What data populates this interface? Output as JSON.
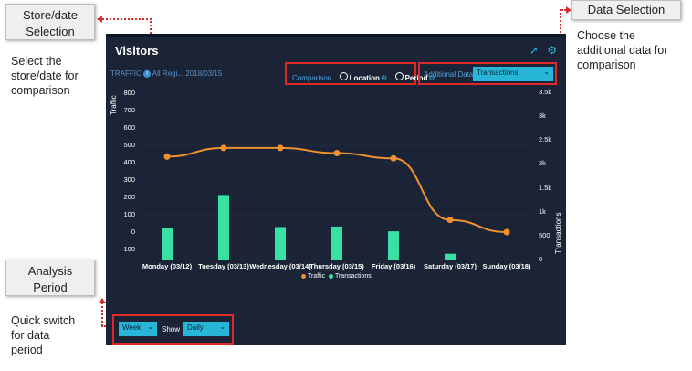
{
  "callouts": {
    "store_date": {
      "line1": "Store/date",
      "line2": "Selection",
      "desc": [
        "Select the",
        "store/date for",
        "comparison"
      ]
    },
    "data_selection": {
      "title": "Data Selection",
      "desc": [
        "Choose the",
        "additional data for",
        "comparison"
      ]
    },
    "analysis_period": {
      "line1": "Analysis",
      "line2": "Period",
      "desc": [
        "Quick switch",
        "for data",
        "period"
      ]
    }
  },
  "panel": {
    "title": "Visitors",
    "traffic_label": "TRAFFIC",
    "traffic_info": "All Regi... 2018/03/15",
    "comparison_label": "Comparison",
    "options": [
      "Location",
      "Period"
    ],
    "additional_label": "Additional Data",
    "additional_value": "Transactions",
    "period_value": "Week",
    "show_label": "Show",
    "show_value": "Daily"
  },
  "colors": {
    "traffic": "#f0912e",
    "transactions": "#39e0a4",
    "panel": "#1b2336",
    "accent": "#27b6d8",
    "highlight": "#e02828"
  },
  "chart_data": {
    "type": "bar",
    "categories": [
      "Monday (03/12)",
      "Tuesday (03/13)",
      "Wednesday (03/14)",
      "Thursday (03/15)",
      "Friday (03/16)",
      "Saturday (03/17)",
      "Sunday (03/18)"
    ],
    "series": [
      {
        "name": "Traffic",
        "type": "line",
        "axis": "left",
        "values": [
          435,
          485,
          485,
          455,
          425,
          70,
          0
        ]
      },
      {
        "name": "Transactions",
        "type": "bar",
        "axis": "right",
        "values": [
          660,
          1350,
          680,
          690,
          590,
          120,
          0
        ]
      }
    ],
    "ylabel": "Traffic",
    "y2label": "Transactions",
    "ylim": [
      -130,
      800
    ],
    "y2lim": [
      -50,
      3500
    ],
    "yticks": [
      800,
      700,
      600,
      500,
      400,
      300,
      200,
      100,
      0,
      -100
    ],
    "y2ticks": [
      "3.5k",
      "3k",
      "2.5k",
      "2k",
      "1.5k",
      "1k",
      "500",
      "0"
    ],
    "y2tick_values": [
      3500,
      3000,
      2500,
      2000,
      1500,
      1000,
      500,
      0
    ],
    "legend": [
      "Traffic",
      "Transactions"
    ]
  }
}
